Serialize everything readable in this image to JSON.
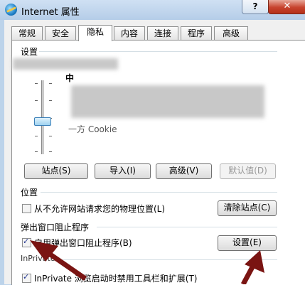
{
  "window": {
    "title": "Internet 属性",
    "help_label": "?",
    "close_label": "✕"
  },
  "tabs": [
    "常规",
    "安全",
    "隐私",
    "内容",
    "连接",
    "程序",
    "高级"
  ],
  "active_tab": "隐私",
  "settings": {
    "label": "设置",
    "level": "中",
    "desc_tail": "一方 Cookie",
    "buttons": {
      "sites": "站点(S)",
      "import": "导入(I)",
      "advanced": "高级(V)",
      "default": "默认值(D)"
    }
  },
  "location": {
    "label": "位置",
    "checkbox": "从不允许网站请求您的物理位置(L)",
    "checked": false,
    "clear": "清除站点(C)"
  },
  "popup": {
    "label": "弹出窗口阻止程序",
    "checkbox": "启用弹出窗口阻止程序(B)",
    "checked": true,
    "settings": "设置(E)"
  },
  "inprivate": {
    "label": "InPrivate",
    "checkbox": "InPrivate 浏览启动时禁用工具栏和扩展(T)",
    "checked": true
  },
  "colors": {
    "arrow": "#7a1412",
    "accent": "#3a7fb8"
  }
}
